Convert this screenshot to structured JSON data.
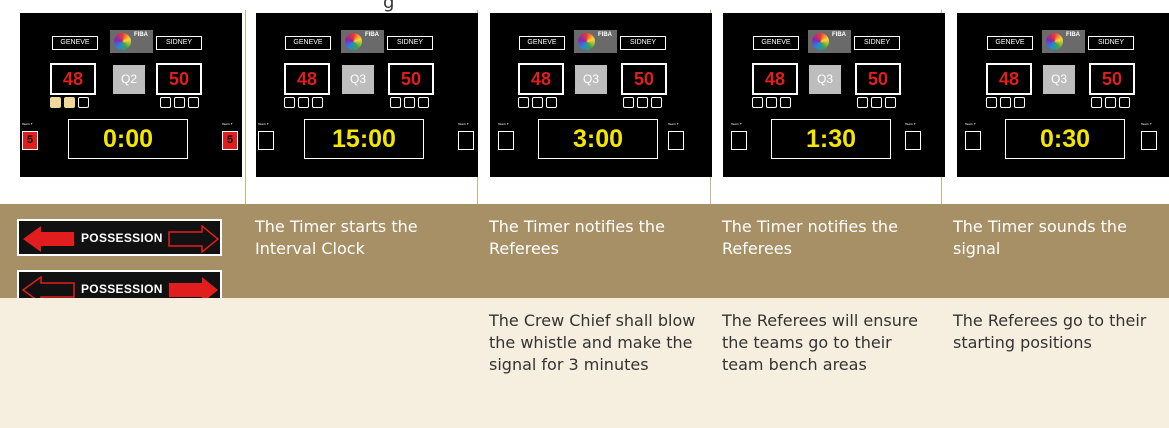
{
  "header_text": "g",
  "boards": [
    {
      "home": "GENEVE",
      "away": "SIDNEY",
      "score_home": "48",
      "score_away": "50",
      "quarter": "Q2",
      "clock": "0:00",
      "timeout_home": "5",
      "timeout_away": "5",
      "team_label": "Team F"
    },
    {
      "home": "GENEVE",
      "away": "SIDNEY",
      "score_home": "48",
      "score_away": "50",
      "quarter": "Q3",
      "clock": "15:00",
      "team_label": "Team F"
    },
    {
      "home": "GENEVE",
      "away": "SIDNEY",
      "score_home": "48",
      "score_away": "50",
      "quarter": "Q3",
      "clock": "3:00",
      "team_label": "Team F"
    },
    {
      "home": "GENEVE",
      "away": "SIDNEY",
      "score_home": "48",
      "score_away": "50",
      "quarter": "Q3",
      "clock": "1:30",
      "team_label": "Team F"
    },
    {
      "home": "GENEVE",
      "away": "SIDNEY",
      "score_home": "48",
      "score_away": "50",
      "quarter": "Q3",
      "clock": "0:30",
      "team_label": "Team F"
    }
  ],
  "fiba_logo_text": "FIBA",
  "possession_label": "POSSESSION",
  "row1": [
    "The Timer starts the Interval Clock",
    "The Timer notifies the Referees",
    "The Timer notifies the Referees",
    "The Timer sounds the signal"
  ],
  "row2": [
    "The Crew Chief shall blow the whistle and make the signal for 3 minutes",
    "The Referees will ensure the teams go to their team bench areas",
    "The Referees go to their starting positions"
  ],
  "colors": {
    "band_gold": "#a89066",
    "band_cream": "#f6eedf",
    "score_red": "#e21d1d",
    "clock_yellow": "#f5e600",
    "arrow_red": "#e21d1d"
  }
}
